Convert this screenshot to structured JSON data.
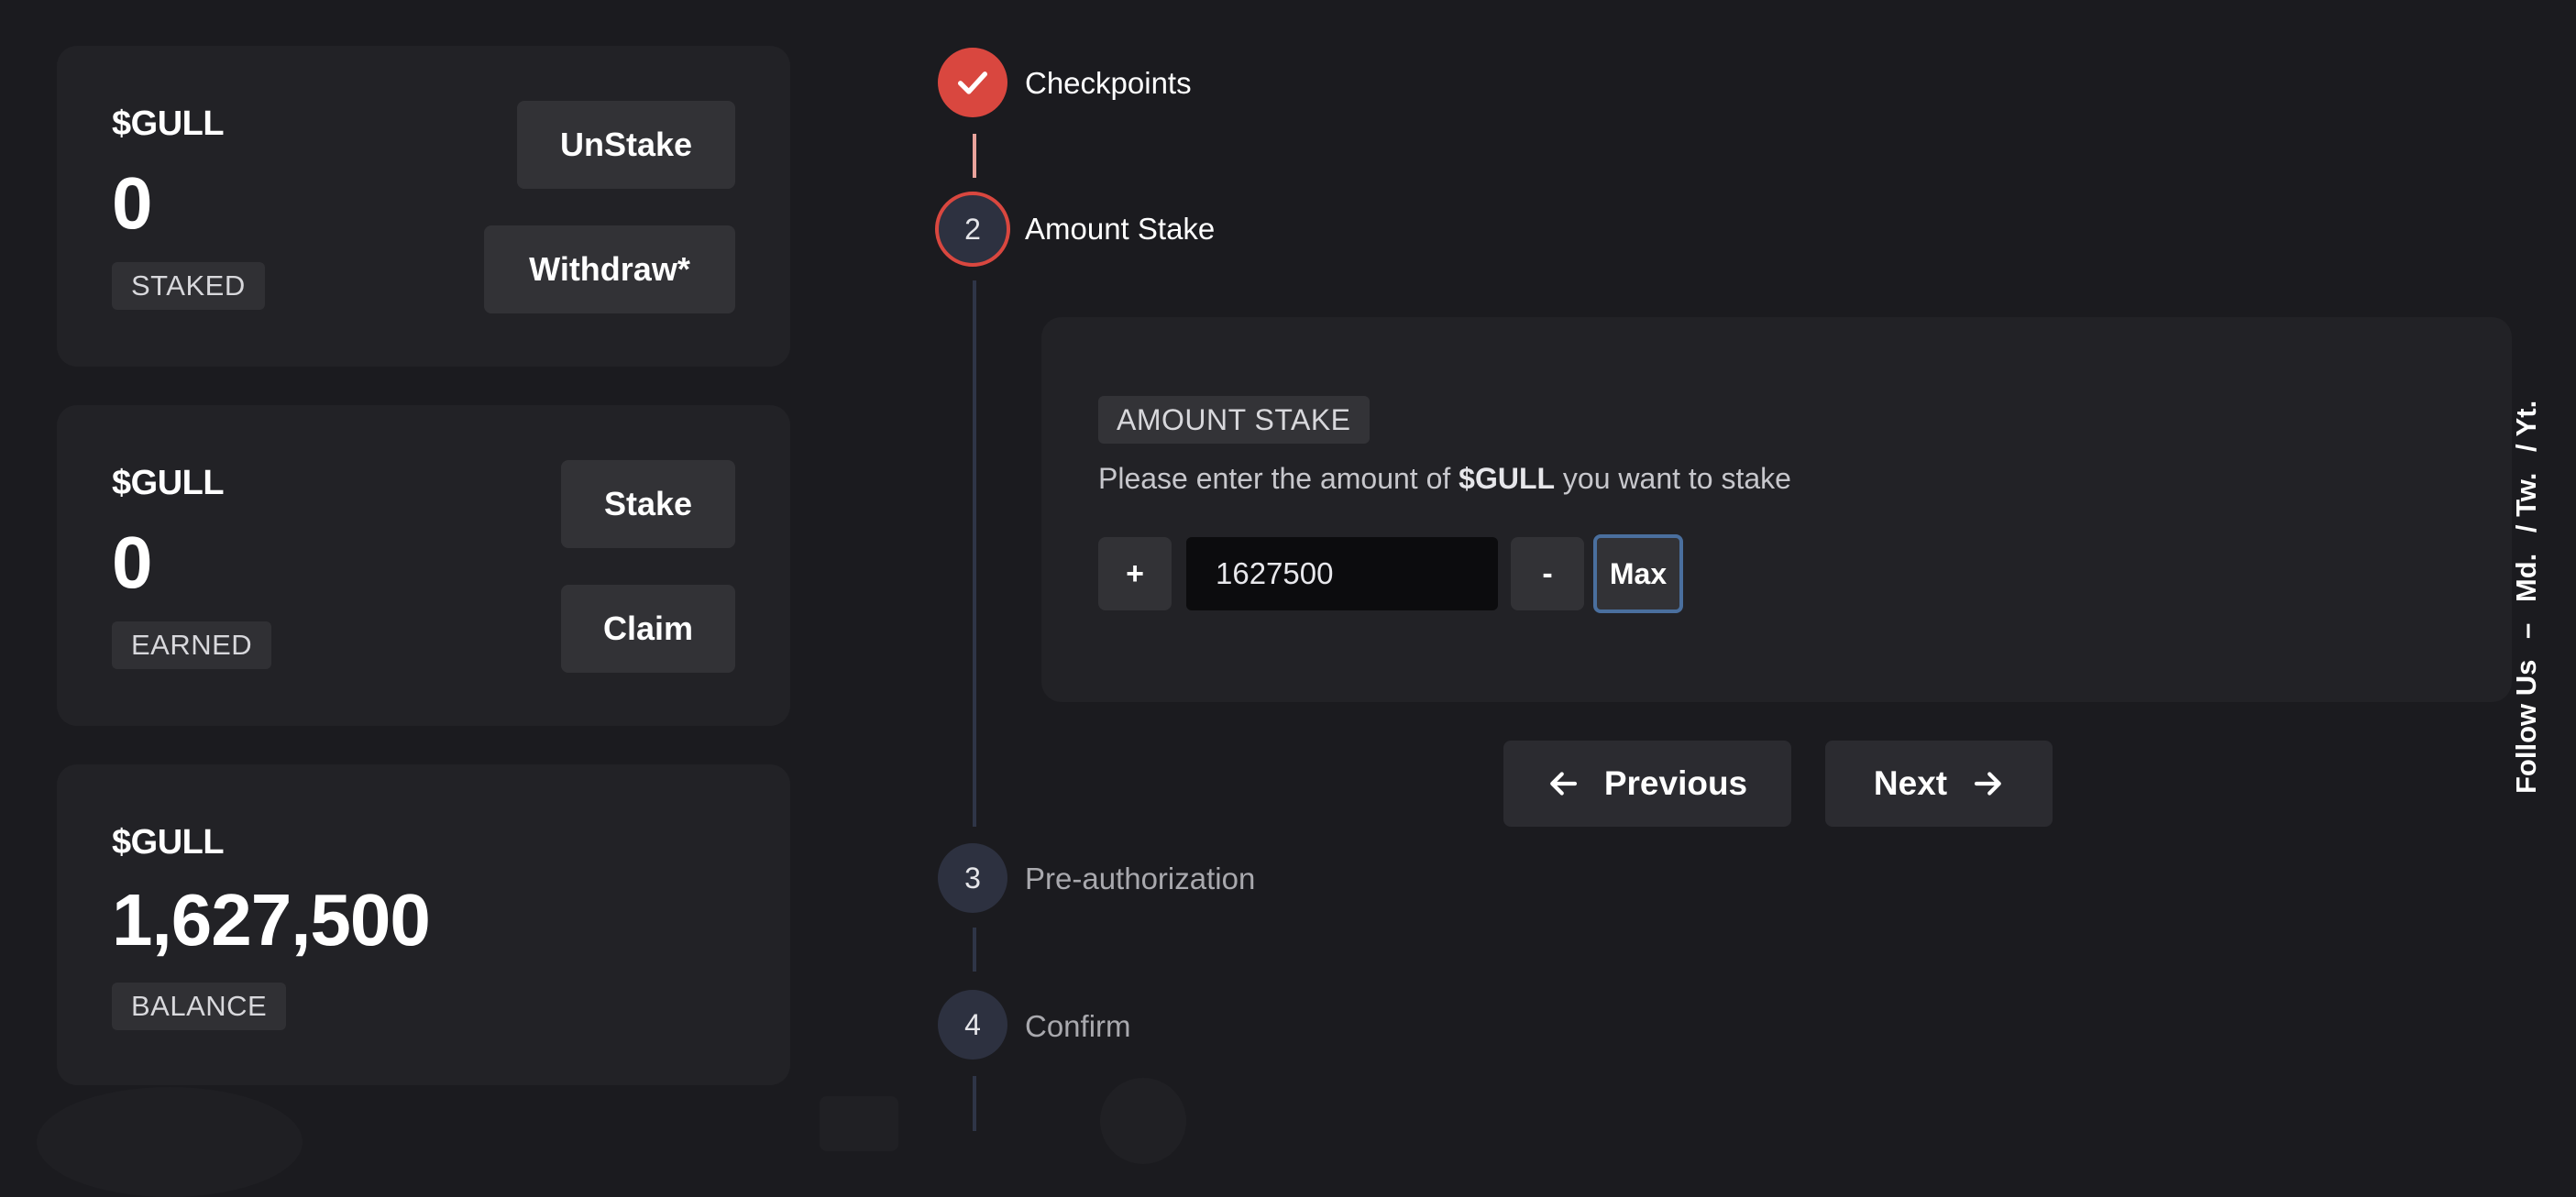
{
  "cards": [
    {
      "token": "$GULL",
      "amount": "0",
      "badge": "STAKED",
      "buttons": [
        "UnStake",
        "Withdraw*"
      ]
    },
    {
      "token": "$GULL",
      "amount": "0",
      "badge": "EARNED",
      "buttons": [
        "Stake",
        "Claim"
      ]
    },
    {
      "token": "$GULL",
      "amount": "1,627,500",
      "badge": "BALANCE"
    }
  ],
  "stepper": {
    "steps": [
      {
        "number": "1",
        "label": "Checkpoints",
        "state": "completed"
      },
      {
        "number": "2",
        "label": "Amount Stake",
        "state": "active"
      },
      {
        "number": "3",
        "label": "Pre-authorization",
        "state": "pending"
      },
      {
        "number": "4",
        "label": "Confirm",
        "state": "pending"
      }
    ]
  },
  "stake_panel": {
    "badge": "AMOUNT STAKE",
    "text_prefix": "Please enter the amount of",
    "text_token": "$GULL",
    "text_suffix": "you want to stake",
    "increment_label": "+",
    "amount_value": "1627500",
    "decrement_label": "-",
    "max_label": "Max"
  },
  "navigation": {
    "previous_label": "Previous",
    "next_label": "Next"
  },
  "follow": {
    "label": "Follow Us",
    "dash": "–",
    "links": [
      "Md.",
      "/ Tw.",
      "/ Yt."
    ]
  },
  "colors": {
    "background": "#1b1b1f",
    "card": "#222226",
    "accent_red": "#d9473f",
    "step_pending": "#2d3140",
    "max_border": "#4a6f9e"
  }
}
